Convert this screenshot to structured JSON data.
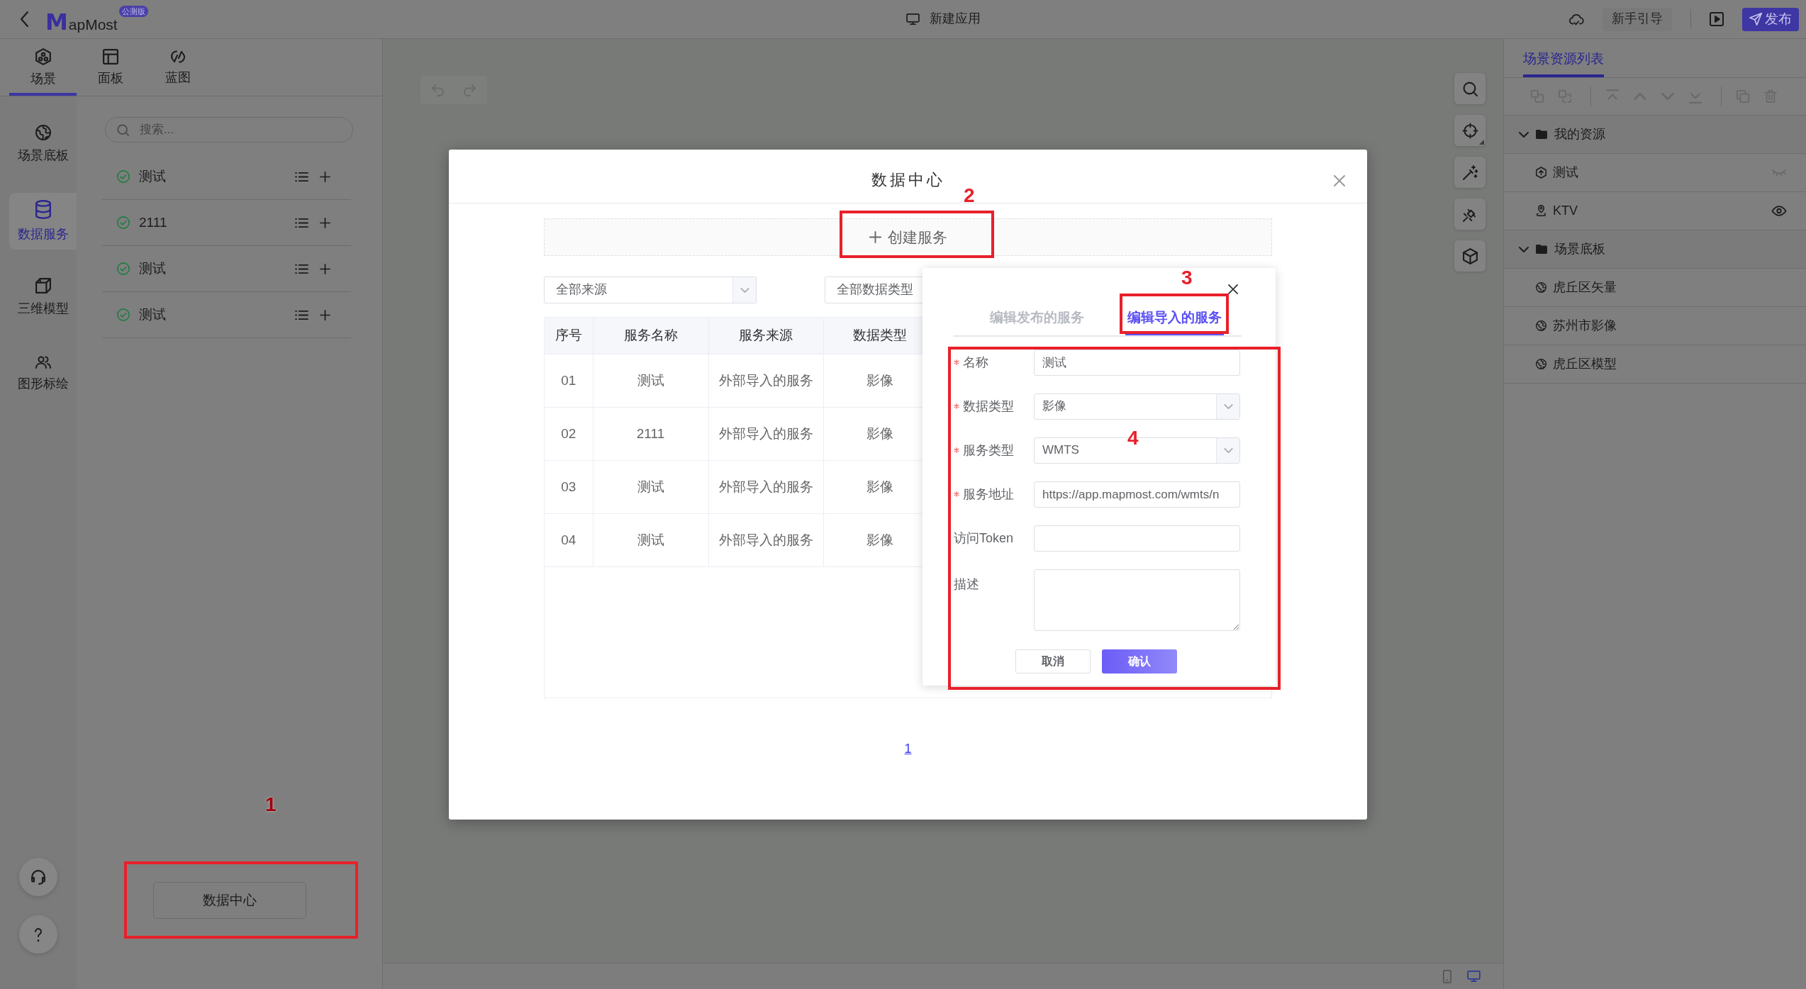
{
  "header": {
    "logo_mark": "M",
    "logo_text": "apMost",
    "badge": "公测版",
    "title": "新建应用",
    "guide_button": "新手引导",
    "publish_button": "发布"
  },
  "mode_tabs": [
    {
      "label": "场景",
      "kind": "scene",
      "selected": true
    },
    {
      "label": "面板",
      "kind": "panel",
      "selected": false
    },
    {
      "label": "蓝图",
      "kind": "blueprint",
      "selected": false
    }
  ],
  "side_nav": [
    {
      "label": "场景底板",
      "kind": "basemap",
      "selected": false
    },
    {
      "label": "数据服务",
      "kind": "data",
      "selected": true
    },
    {
      "label": "三维模型",
      "kind": "model",
      "selected": false
    },
    {
      "label": "图形标绘",
      "kind": "plotting",
      "selected": false
    }
  ],
  "data_panel": {
    "search": {
      "placeholder": "搜索..."
    },
    "items": [
      {
        "name": "测试"
      },
      {
        "name": "2111"
      },
      {
        "name": "测试"
      },
      {
        "name": "测试"
      }
    ],
    "data_center_button": {
      "label": "数据中心",
      "annotation": "1"
    }
  },
  "map": {
    "history": [
      {
        "kind": "undo",
        "disabled": true
      },
      {
        "kind": "redo",
        "disabled": true
      }
    ],
    "device_switch": [
      {
        "kind": "phone",
        "selected": false
      },
      {
        "kind": "desktop",
        "selected": true
      }
    ]
  },
  "resource_panel": {
    "tab": {
      "label": "场景资源列表",
      "selected": true
    },
    "toolbar_groups": [
      {
        "buttons": [
          {
            "kind": "group",
            "disabled": true
          },
          {
            "kind": "ungroup",
            "disabled": true
          }
        ]
      },
      {
        "buttons": [
          {
            "kind": "top",
            "disabled": true
          },
          {
            "kind": "up",
            "disabled": true
          },
          {
            "kind": "down",
            "disabled": true
          },
          {
            "kind": "bottom",
            "disabled": true
          }
        ]
      },
      {
        "buttons": [
          {
            "kind": "copy",
            "disabled": true
          },
          {
            "kind": "delete",
            "disabled": true
          }
        ]
      }
    ],
    "tree": [
      {
        "name": "我的资源",
        "expanded": true,
        "children": [
          {
            "name": "测试",
            "kind": "service",
            "visible": false
          },
          {
            "name": "KTV",
            "kind": "marker",
            "visible": true
          }
        ]
      },
      {
        "name": "场景底板",
        "expanded": true,
        "children": [
          {
            "name": "虎丘区矢量",
            "kind": "basemap"
          },
          {
            "name": "苏州市影像",
            "kind": "basemap"
          },
          {
            "name": "虎丘区模型",
            "kind": "basemap"
          }
        ]
      }
    ]
  },
  "modal": {
    "title": "数据中心",
    "create_button": {
      "label": "创建服务",
      "annotation": "2"
    },
    "filters": [
      {
        "value": "全部来源"
      },
      {
        "value": "全部数据类型"
      }
    ],
    "table": {
      "columns": [
        "序号",
        "服务名称",
        "服务来源",
        "数据类型"
      ],
      "rows": [
        [
          "01",
          "测试",
          "外部导入的服务",
          "影像"
        ],
        [
          "02",
          "2111",
          "外部导入的服务",
          "影像"
        ],
        [
          "03",
          "测试",
          "外部导入的服务",
          "影像"
        ],
        [
          "04",
          "测试",
          "外部导入的服务",
          "影像"
        ]
      ]
    },
    "pagination": [
      {
        "label": "1",
        "selected": true
      }
    ],
    "edit_popover": {
      "tabs": [
        {
          "label": "编辑发布的服务",
          "selected": false
        },
        {
          "label": "编辑导入的服务",
          "selected": true,
          "annotation": "3"
        }
      ],
      "annotation": "4",
      "fields": [
        {
          "label": "名称",
          "required": true,
          "kind": "text",
          "value": "测试"
        },
        {
          "label": "数据类型",
          "required": true,
          "kind": "select",
          "value": "影像"
        },
        {
          "label": "服务类型",
          "required": true,
          "kind": "select",
          "value": "WMTS"
        },
        {
          "label": "服务地址",
          "required": true,
          "kind": "text",
          "value": "https://app.mapmost.com/wmts/n"
        },
        {
          "label": "访问Token",
          "required": false,
          "kind": "text"
        },
        {
          "label": "描述",
          "required": false,
          "kind": "textarea"
        }
      ],
      "cancel_button": "取消",
      "confirm_button": "确认"
    }
  }
}
